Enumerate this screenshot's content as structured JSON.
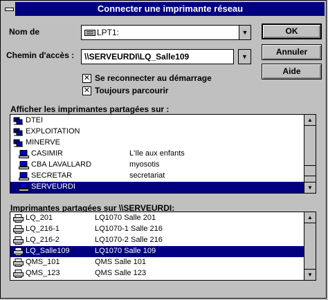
{
  "window": {
    "title": "Connecter une imprimante réseau"
  },
  "form": {
    "nom_de_label": "Nom de",
    "nom_de_value": "LPT1:",
    "chemin_label": "Chemin d'accès :",
    "chemin_value": "\\\\SERVEURDI\\LQ_Salle109",
    "reconnect_label": "Se reconnecter au démarrage",
    "reconnect_checked": true,
    "browse_label": "Toujours parcourir",
    "browse_checked": true
  },
  "buttons": {
    "ok": "OK",
    "annuler": "Annuler",
    "aide": "Aide"
  },
  "shared_on": {
    "label": "Afficher les imprimantes partagées sur :",
    "items": [
      {
        "name": "DTEI",
        "desc": "",
        "icon": "network-group-icon",
        "indent": 0,
        "selected": false
      },
      {
        "name": "EXPLOITATION",
        "desc": "",
        "icon": "network-group-icon",
        "indent": 0,
        "selected": false
      },
      {
        "name": "MINERVE",
        "desc": "",
        "icon": "network-group-icon",
        "indent": 0,
        "selected": false
      },
      {
        "name": "CASIMIR",
        "desc": "L'Ile aux enfants",
        "icon": "computer-icon",
        "indent": 1,
        "selected": false
      },
      {
        "name": "CBA LAVALLARD",
        "desc": "myosotis",
        "icon": "computer-icon",
        "indent": 1,
        "selected": false
      },
      {
        "name": "SECRETAR",
        "desc": "secretariat",
        "icon": "computer-icon",
        "indent": 1,
        "selected": false
      },
      {
        "name": "SERVEURDI",
        "desc": "",
        "icon": "computer-icon",
        "indent": 1,
        "selected": true
      }
    ]
  },
  "printers": {
    "label": "Imprimantes partagées sur \\\\SERVEURDI:",
    "items": [
      {
        "name": "LQ_201",
        "desc": "LQ1070 Salle 201",
        "icon": "printer-icon",
        "selected": false
      },
      {
        "name": "LQ_216-1",
        "desc": "LQ1070-1 Salle 216",
        "icon": "printer-icon",
        "selected": false
      },
      {
        "name": "LQ_216-2",
        "desc": "LQ1070-2 Salle 216",
        "icon": "printer-icon",
        "selected": false
      },
      {
        "name": "LQ_Salle109",
        "desc": "LQ1070 Salle 109",
        "icon": "printer-icon",
        "selected": true
      },
      {
        "name": "QMS_101",
        "desc": "QMS Salle 101",
        "icon": "printer-icon",
        "selected": false
      },
      {
        "name": "QMS_123",
        "desc": "QMS Salle 123",
        "icon": "printer-icon",
        "selected": false
      }
    ]
  },
  "colors": {
    "title_bar": "#000080",
    "selection": "#000080",
    "face": "#c0c0c0"
  }
}
